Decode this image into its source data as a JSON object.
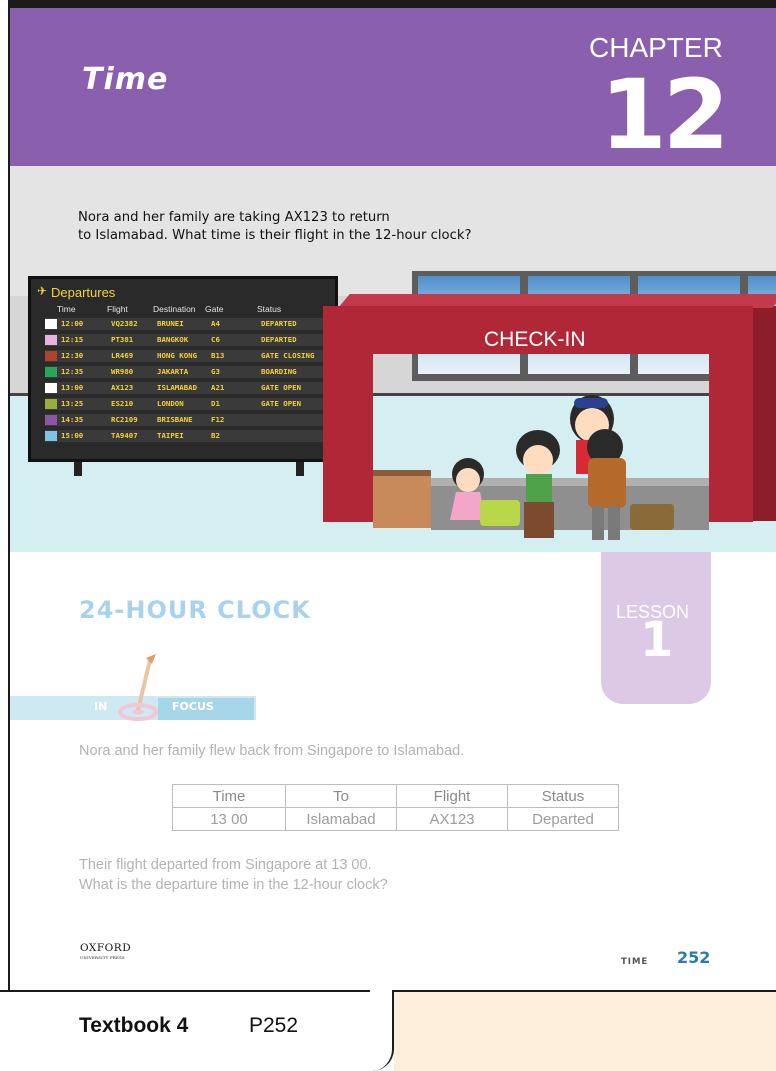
{
  "chapter": {
    "title": "Time",
    "label": "CHAPTER",
    "number": "12"
  },
  "scene": {
    "question_line1": "Nora and her family are taking AX123 to return",
    "question_line2": "to Islamabad. What time is their flight in the 12-hour clock?",
    "board": {
      "icon": "airplane-departure-icon",
      "title": "Departures",
      "headers": [
        "Time",
        "Flight",
        "Destination",
        "Gate",
        "Status"
      ],
      "rows": [
        {
          "color": "#ffffff",
          "time": "12:00",
          "flight": "VQ2382",
          "destination": "BRUNEI",
          "gate": "A4",
          "status": "DEPARTED"
        },
        {
          "color": "#e6b3e0",
          "time": "12:15",
          "flight": "PT381",
          "destination": "BANGKOK",
          "gate": "C6",
          "status": "DEPARTED"
        },
        {
          "color": "#b0422c",
          "time": "12:30",
          "flight": "LR469",
          "destination": "HONG KONG",
          "gate": "B13",
          "status": "GATE CLOSING"
        },
        {
          "color": "#27a65a",
          "time": "12:35",
          "flight": "WR980",
          "destination": "JAKARTA",
          "gate": "G3",
          "status": "BOARDING"
        },
        {
          "color": "#ffffff",
          "time": "13:00",
          "flight": "AX123",
          "destination": "ISLAMABAD",
          "gate": "A21",
          "status": "GATE OPEN"
        },
        {
          "color": "#9aae3c",
          "time": "13:25",
          "flight": "ES210",
          "destination": "LONDON",
          "gate": "D1",
          "status": "GATE OPEN"
        },
        {
          "color": "#8b55a8",
          "time": "14:35",
          "flight": "RC2109",
          "destination": "BRISBANE",
          "gate": "F12",
          "status": ""
        },
        {
          "color": "#7ec3ea",
          "time": "15:00",
          "flight": "TA9407",
          "destination": "TAIPEI",
          "gate": "B2",
          "status": ""
        }
      ]
    },
    "counter_sign": "CHECK-IN"
  },
  "lesson": {
    "section_title": "24-HOUR CLOCK",
    "label": "LESSON",
    "number": "1",
    "focus_in": "IN",
    "focus_word": "FOCUS",
    "intro": "Nora and her family flew back from Singapore to Islamabad.",
    "table": {
      "headers": [
        "Time",
        "To",
        "Flight",
        "Status"
      ],
      "row": [
        "13 00",
        "Islamabad",
        "AX123",
        "Departed"
      ]
    },
    "question_line1": "Their flight departed from Singapore at 13 00.",
    "question_line2": "What is the departure time in the 12-hour clock?"
  },
  "footer": {
    "publisher": "OXFORD",
    "publisher_sub": "UNIVERSITY PRESS",
    "running_head": "TIME",
    "page_number": "252"
  },
  "reference": {
    "book": "Textbook 4",
    "page": "P252"
  }
}
